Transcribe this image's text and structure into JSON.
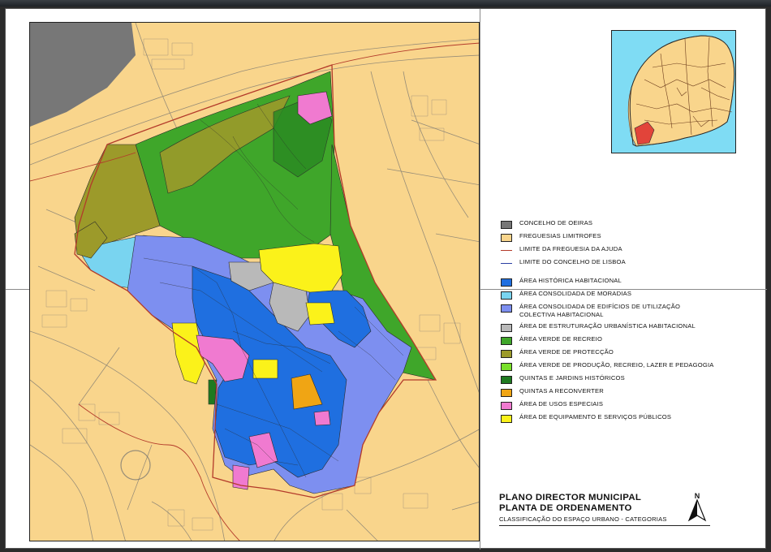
{
  "legend": {
    "items": [
      {
        "label": "CONCELHO DE OEIRAS",
        "kind": "box",
        "color": "#777777"
      },
      {
        "label": "FREGUESIAS LIMITROFES",
        "kind": "box",
        "color": "#f9d58c"
      },
      {
        "label": "LIMITE DA FREGUESIA DA AJUDA",
        "kind": "line",
        "color": "#b33a2a"
      },
      {
        "label": "LIMITE DO CONCELHO DE LISBOA",
        "kind": "line",
        "color": "#2b3fa3"
      },
      {
        "label": "ÁREA HISTÓRICA HABITACIONAL",
        "kind": "box",
        "color": "#1f6fe0"
      },
      {
        "label": "ÁREA CONSOLIDADA DE MORADIAS",
        "kind": "box",
        "color": "#79d4f0"
      },
      {
        "label": "ÁREA CONSOLIDADA DE EDIFÍCIOS DE UTILIZAÇÃO\nCOLECTIVA HABITACIONAL",
        "kind": "box",
        "color": "#7d8ff0"
      },
      {
        "label": "ÁREA DE ESTRUTURAÇÃO URBANÍSTICA HABITACIONAL",
        "kind": "box",
        "color": "#b9b9b9"
      },
      {
        "label": "ÁREA VERDE DE RECREIO",
        "kind": "box",
        "color": "#3fa62a"
      },
      {
        "label": "ÁREA VERDE DE PROTECÇÃO",
        "kind": "box",
        "color": "#9c9a2a"
      },
      {
        "label": "ÁREA VERDE DE PRODUÇÃO, RECREIO, LAZER E PEDAGOGIA",
        "kind": "box",
        "color": "#79e02a"
      },
      {
        "label": "QUINTAS E JARDINS HISTÓRICOS",
        "kind": "box",
        "color": "#1f7a20"
      },
      {
        "label": "QUINTAS A RECONVERTER",
        "kind": "box",
        "color": "#f0a514"
      },
      {
        "label": "ÁREA DE USOS ESPECIAIS",
        "kind": "box",
        "color": "#f07ad0"
      },
      {
        "label": "ÁREA DE EQUIPAMENTO E SERVIÇOS PÚBLICOS",
        "kind": "box",
        "color": "#fbf21a"
      }
    ]
  },
  "title": {
    "line1": "PLANO DIRECTOR MUNICIPAL",
    "line2": "PLANTA DE ORDENAMENTO",
    "subtitle": "CLASSIFICAÇÃO DO ESPAÇO URBANO - CATEGORIAS"
  },
  "north_arrow": {
    "label": "N"
  },
  "colors": {
    "background_parishes": "#f9d58c",
    "oeiras": "#777777",
    "river": "#7fdcf4",
    "inset_highlight": "#e2443a",
    "street_lines": "#6f6f6f"
  }
}
